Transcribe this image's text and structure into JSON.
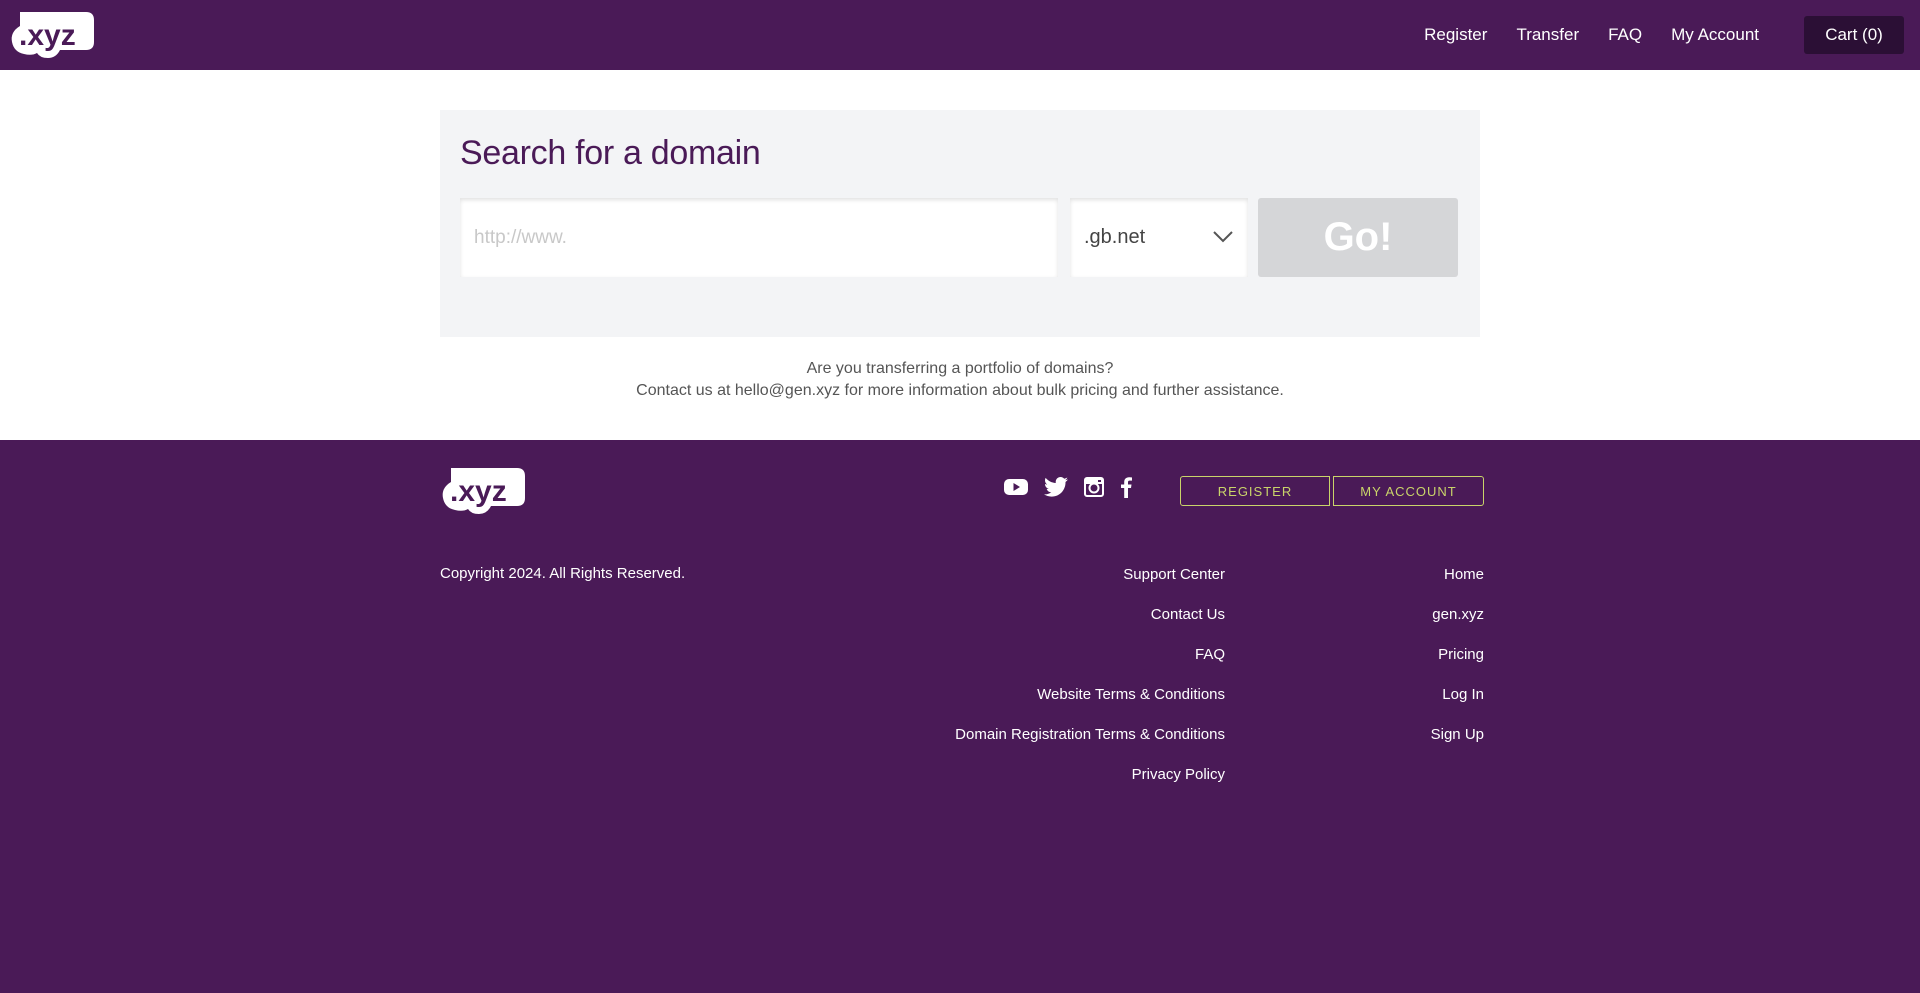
{
  "header": {
    "logo_text": ".xyz",
    "nav": [
      "Register",
      "Transfer",
      "FAQ",
      "My Account"
    ],
    "cart_label": "Cart (0)"
  },
  "search": {
    "title": "Search for a domain",
    "input_placeholder": "http://www.",
    "input_value": "",
    "tld_selected": ".gb.net",
    "go_label": "Go!"
  },
  "transfer_note": {
    "line1": "Are you transferring a portfolio of domains?",
    "line2": "Contact us at hello@gen.xyz for more information about bulk pricing and further assistance."
  },
  "footer": {
    "logo_text": ".xyz",
    "social_icons": [
      "youtube-icon",
      "twitter-icon",
      "instagram-icon",
      "facebook-icon"
    ],
    "register_button": "REGISTER",
    "my_account_button": "MY ACCOUNT",
    "copyright": "Copyright 2024. All Rights Reserved.",
    "links_col1": [
      "Support Center",
      "Contact Us",
      "FAQ",
      "Website Terms & Conditions",
      "Domain Registration Terms & Conditions",
      "Privacy Policy"
    ],
    "links_col2": [
      "Home",
      "gen.xyz",
      "Pricing",
      "Log In",
      "Sign Up"
    ]
  },
  "colors": {
    "brand_purple": "#4a1a57",
    "cart_bg": "#2b0f35",
    "accent_lime": "#c9d46a",
    "go_disabled": "#d5d6d8"
  }
}
